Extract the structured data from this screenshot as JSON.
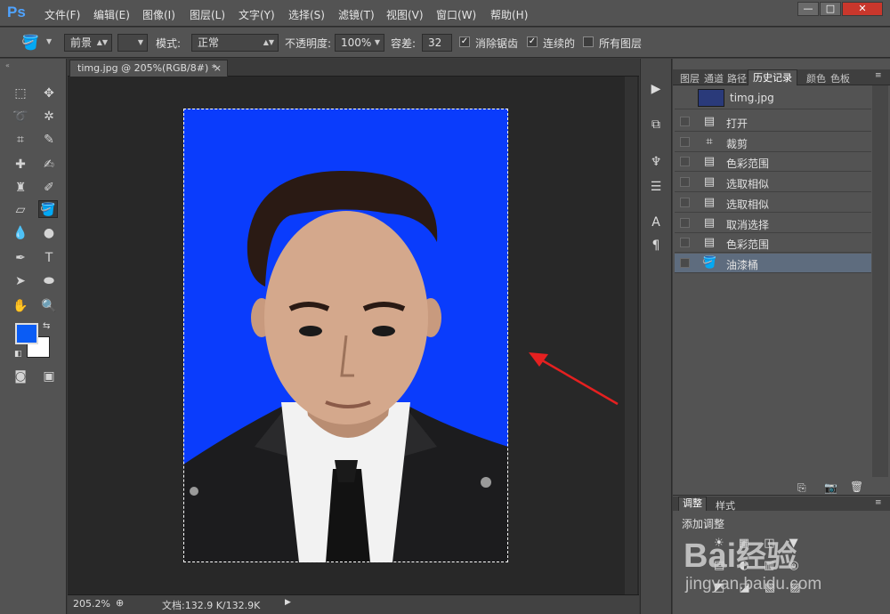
{
  "app": {
    "logo": "Ps"
  },
  "menu": [
    "文件(F)",
    "编辑(E)",
    "图像(I)",
    "图层(L)",
    "文字(Y)",
    "选择(S)",
    "滤镜(T)",
    "视图(V)",
    "窗口(W)",
    "帮助(H)"
  ],
  "window_controls": {
    "minimize": "—",
    "restore": "□",
    "close": "✕"
  },
  "options": {
    "fill_source": "前景",
    "mode_label": "模式:",
    "mode_value": "正常",
    "opacity_label": "不透明度:",
    "opacity_value": "100%",
    "tolerance_label": "容差:",
    "tolerance_value": "32",
    "antialias_label": "消除锯齿",
    "antialias_checked": true,
    "contiguous_label": "连续的",
    "contiguous_checked": true,
    "all_layers_label": "所有图层",
    "all_layers_checked": false
  },
  "document": {
    "tab_title": "timg.jpg @ 205%(RGB/8#) *",
    "tab_close": "×",
    "zoom": "205.2%",
    "doc_info": "文档:132.9 K/132.9K",
    "canvas_fill": "#0a3cfc"
  },
  "colors": {
    "foreground": "#0a5cf5",
    "background": "#ffffff"
  },
  "panel_tabs": [
    "图层",
    "通道",
    "路径",
    "历史记录",
    "颜色",
    "色板"
  ],
  "panel_active_tab": "历史记录",
  "history": {
    "snapshot": "timg.jpg",
    "items": [
      {
        "label": "打开",
        "icon": "document-icon"
      },
      {
        "label": "裁剪",
        "icon": "crop-icon"
      },
      {
        "label": "色彩范围",
        "icon": "document-icon"
      },
      {
        "label": "选取相似",
        "icon": "document-icon"
      },
      {
        "label": "选取相似",
        "icon": "document-icon"
      },
      {
        "label": "取消选择",
        "icon": "document-icon"
      },
      {
        "label": "色彩范围",
        "icon": "document-icon"
      },
      {
        "label": "油漆桶",
        "icon": "paint-bucket-icon",
        "active": true
      }
    ]
  },
  "adjust_tabs": [
    "调整",
    "样式"
  ],
  "adjust_title": "添加调整",
  "watermark": {
    "brand": "Bai",
    "brand2": "经验",
    "url": "jingyan.baidu.com"
  }
}
